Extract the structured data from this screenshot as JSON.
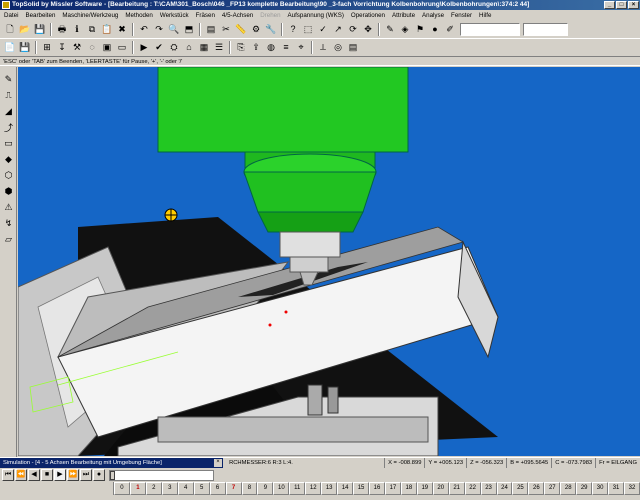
{
  "window": {
    "title": "TopSolid by Missler Software - [Bearbeitung : T:\\CAM\\301_Bosch\\046 _FP13 komplette Bearbeitung\\90 _3-fach Vorrichtung Kolbenbohrung\\Kolbenbohrungen\\:374:2 44]",
    "min": "_",
    "max": "□",
    "close": "×"
  },
  "menu": [
    "Datei",
    "Bearbeiten",
    "Maschine/Werkzeug",
    "Methoden",
    "Werkstück",
    "Fräsen",
    "4/5-Achsen",
    "Drehen",
    "Aufspannung (WKS)",
    "Operationen",
    "Attribute",
    "Analyse",
    "Fenster",
    "Hilfe"
  ],
  "menu_disabled": [
    "Drehen"
  ],
  "message": "'ESC' oder 'TAB' zum Beenden, 'LEERTASTE' für Pause, '+', '-' oder '/'",
  "toolbar1_icons": [
    "new-icon",
    "open-icon",
    "save-icon",
    "print-icon",
    "info-icon",
    "copy-icon",
    "paste-icon",
    "delete-icon",
    "undo-icon",
    "redo-icon",
    "zoom-icon",
    "view-icon",
    "layer-icon",
    "cut-icon",
    "measure-icon",
    "settings-icon",
    "tool-icon",
    "help-icon",
    "select-icon",
    "pick-icon",
    "arrow-icon",
    "rotate-icon",
    "pan-icon",
    "edit-icon",
    "material-icon",
    "filter-icon",
    "color-icon",
    "pen-icon"
  ],
  "toolbar1_glyphs": [
    "🗋",
    "📂",
    "💾",
    "🖶",
    "ℹ",
    "⧉",
    "📋",
    "✖",
    "↶",
    "↷",
    "🔍",
    "⬒",
    "▤",
    "✂",
    "📏",
    "⚙",
    "🔧",
    "?",
    "⬚",
    "✓",
    "↗",
    "⟳",
    "✥",
    "✎",
    "◈",
    "⚑",
    "●",
    "✐"
  ],
  "toolbar2_icons": [
    "open-doc-icon",
    "save-doc-icon",
    "operation-icon",
    "drill-icon",
    "mill-icon",
    "contour-icon",
    "pocket-icon",
    "face-icon",
    "simulate-icon",
    "check-icon",
    "machine-icon",
    "fixture-icon",
    "stock-icon",
    "tool-list-icon",
    "program-icon",
    "post-icon",
    "nc-icon",
    "report-icon",
    "setup-icon",
    "axes-icon",
    "probe-icon",
    "list-icon"
  ],
  "toolbar2_glyphs": [
    "📄",
    "💾",
    "⊞",
    "↧",
    "⚒",
    "◌",
    "▣",
    "▭",
    "▶",
    "✔",
    "⛭",
    "⌂",
    "▦",
    "☰",
    "⎘",
    "⇪",
    "◍",
    "≡",
    "⌖",
    "⟂",
    "◎",
    "▤"
  ],
  "left_tools": [
    "✎",
    "⎍",
    "◢",
    "⤴",
    "▭",
    "◆",
    "⬡",
    "⬢",
    "⚠",
    "↯",
    "▱"
  ],
  "left_tool_names": [
    "sketch-tool-icon",
    "line-tool-icon",
    "shape-tool-icon",
    "curve-tool-icon",
    "solid-tool-icon",
    "surface-tool-icon",
    "op-tool-icon",
    "op2-tool-icon",
    "warning-tool-icon",
    "path-tool-icon",
    "frame-tool-icon"
  ],
  "status": {
    "sim_title": "Simulation - [4 - 5 Achsen Bearbeitung mit Umgebung Fläche]",
    "close": "×",
    "message": "RCHMESSER:6 R:3 L:4.",
    "coords": [
      "X = -008.899",
      "Y = +005.123",
      "Z = -056.323",
      "B = +095.5645",
      "C = -073.7983",
      "Fr = EILGANG"
    ]
  },
  "sim_buttons": [
    "⏮",
    "⏪",
    "◀",
    "■",
    "▶",
    "⏩",
    "⏭",
    "●"
  ],
  "sim_slider_value": 0.0,
  "timeline": {
    "cells": [
      "0",
      "1",
      "2",
      "3",
      "4",
      "5",
      "6",
      "7",
      "8",
      "9",
      "10",
      "11",
      "12",
      "13",
      "14",
      "15",
      "16",
      "17",
      "18",
      "19",
      "20",
      "21",
      "22",
      "23",
      "24",
      "25",
      "26",
      "27",
      "28",
      "29",
      "30",
      "31",
      "32"
    ],
    "highlight": [
      "1",
      "7"
    ]
  },
  "colors": {
    "viewport_bg": "#1566c6",
    "spindle_green": "#22c822",
    "titlebar": "#0a246a"
  }
}
